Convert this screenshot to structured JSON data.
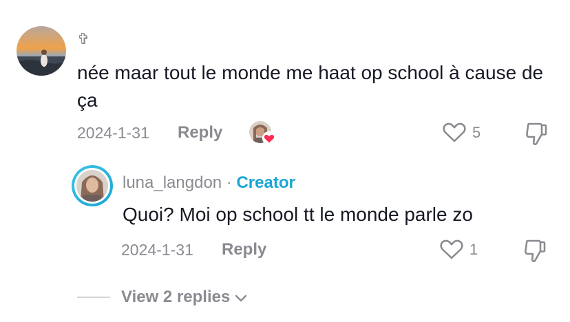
{
  "comment": {
    "username": "✞",
    "text": "née maar tout le monde me haat op school à cause de ça",
    "date": "2024-1-31",
    "reply_label": "Reply",
    "like_count": "5"
  },
  "reply": {
    "username": "luna_langdon",
    "separator": " · ",
    "badge": "Creator",
    "text": "Quoi? Moi op school tt le monde parle zo",
    "date": "2024-1-31",
    "reply_label": "Reply",
    "like_count": "1"
  },
  "view_replies": {
    "label": "View 2 replies",
    "chevron": "⌄"
  },
  "colors": {
    "creator_badge": "#1aa6d3",
    "heart_accent": "#fe2c55",
    "muted_text": "#8a8b91"
  }
}
